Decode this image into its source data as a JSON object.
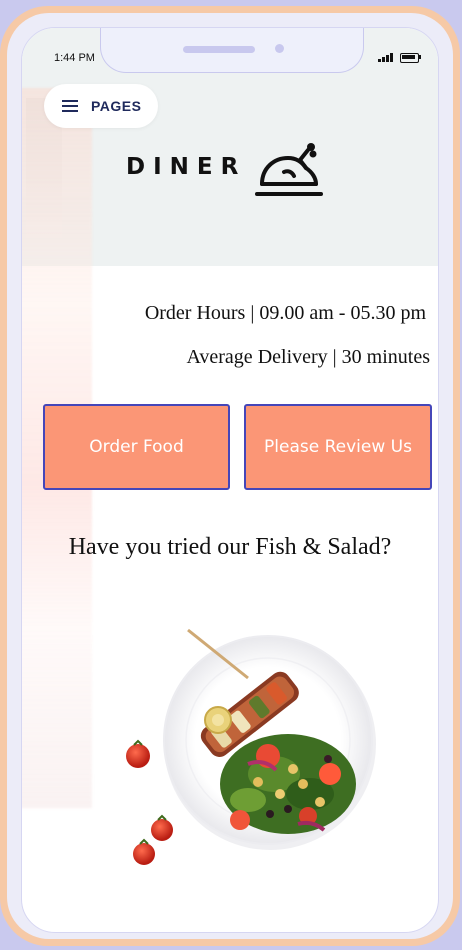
{
  "status_bar": {
    "time": "1:44 PM"
  },
  "nav": {
    "pages_label": "PAGES"
  },
  "brand": {
    "name": "DINER"
  },
  "info": {
    "order_hours": "Order Hours | 09.00 am - 05.30 pm",
    "average_delivery": "Average Delivery | 30 minutes"
  },
  "actions": {
    "order_food": "Order Food",
    "review": "Please Review Us"
  },
  "promo": {
    "headline": "Have you tried our Fish & Salad?"
  },
  "colors": {
    "button_fill": "#fb9676",
    "button_border": "#4546b9",
    "frame": "#f6c9a6",
    "background": "#c9c9ee",
    "nav_text": "#1f2a5c"
  },
  "icons": [
    "menu-icon",
    "chicken-icon",
    "signal-icon",
    "battery-icon"
  ]
}
